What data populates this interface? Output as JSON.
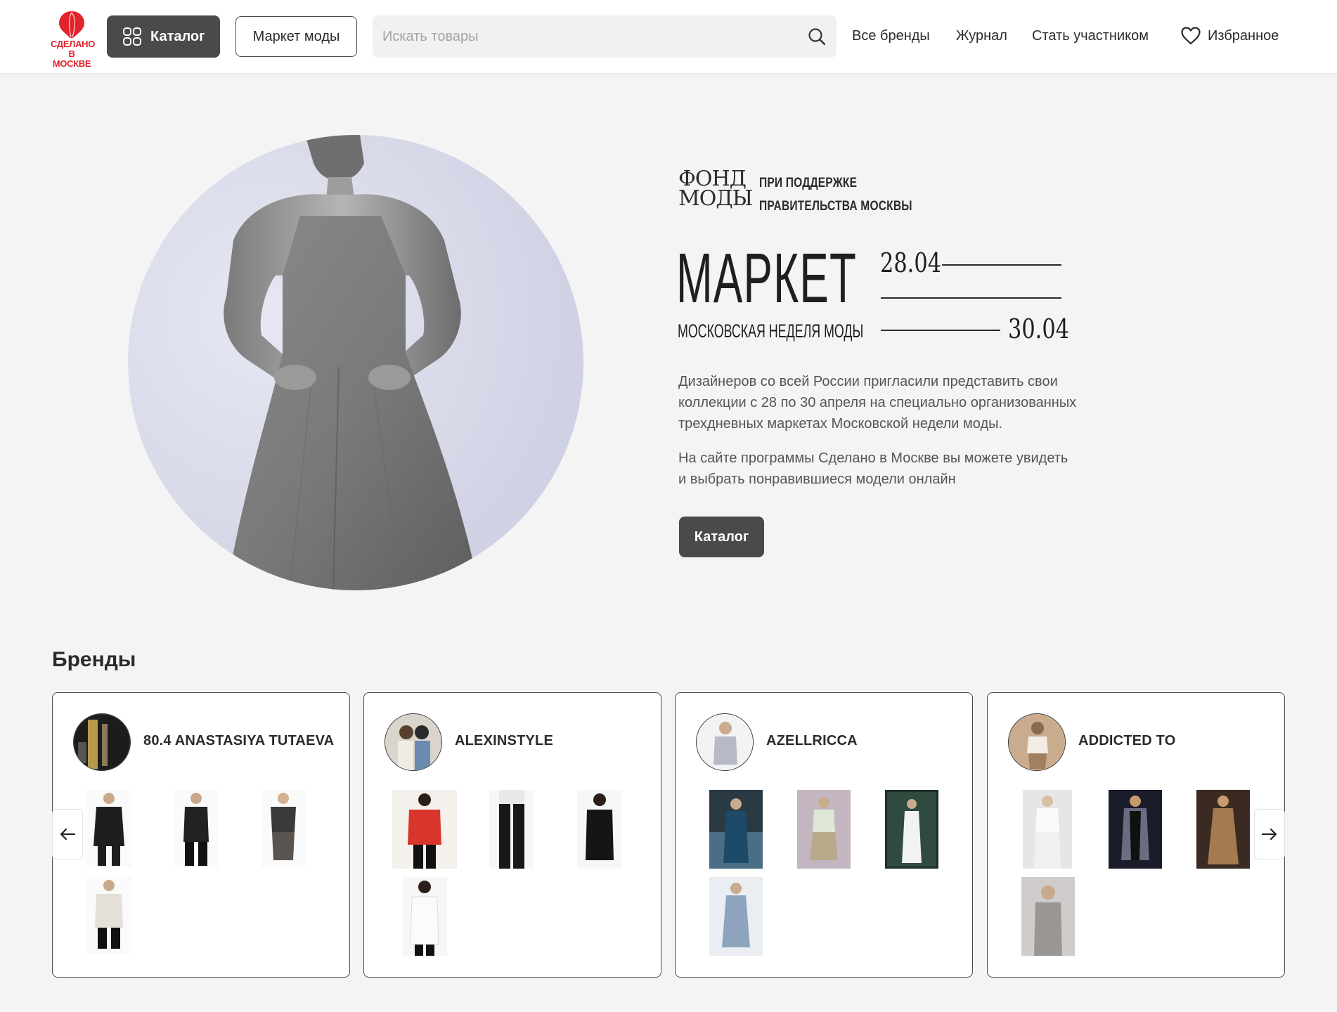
{
  "header": {
    "logo_alt": "СДЕЛАНО В МОСКВЕ",
    "catalog_label": "Каталог",
    "market_label": "Маркет моды",
    "search_placeholder": "Искать товары",
    "nav": [
      "Все бренды",
      "Журнал",
      "Стать участником"
    ],
    "favorites_label": "Избранное"
  },
  "hero": {
    "fund_logo": [
      "ФОНД",
      "МОДЫ"
    ],
    "support_lines": [
      "ПРИ ПОДДЕРЖКЕ",
      "ПРАВИТЕЛЬСТВА МОСКВЫ"
    ],
    "title": "МАРКЕТ",
    "subtitle": "МОСКОВСКАЯ НЕДЕЛЯ МОДЫ",
    "date_start": "28.04",
    "date_end": "30.04",
    "paragraph_1": "Дизайнеров со всей России пригласили представить свои коллекции с 28 по 30 апреля на специально организованных трехдневных маркетах Московской недели моды.",
    "paragraph_2": "На сайте программы Сделано в Москве вы можете увидеть и выбрать понравившиеся модели онлайн",
    "button_label": "Каталог"
  },
  "brands": {
    "title": "Бренды",
    "items": [
      {
        "name": "80.4 ANASTASIYA TUTAEVA",
        "product_count": 4
      },
      {
        "name": "ALEXINSTYLE",
        "product_count": 4
      },
      {
        "name": "AZELLRICCA",
        "product_count": 4
      },
      {
        "name": "ADDICTED TO",
        "product_count": 4
      }
    ]
  },
  "colors": {
    "brand_red": "#e2232b",
    "dark_button": "#4a4a4a",
    "page_bg": "#f4f4f4"
  },
  "icons": {
    "catalog": "grid-icon",
    "search": "search-icon",
    "favorites": "heart-icon",
    "prev": "arrow-left-icon",
    "next": "arrow-right-icon"
  }
}
